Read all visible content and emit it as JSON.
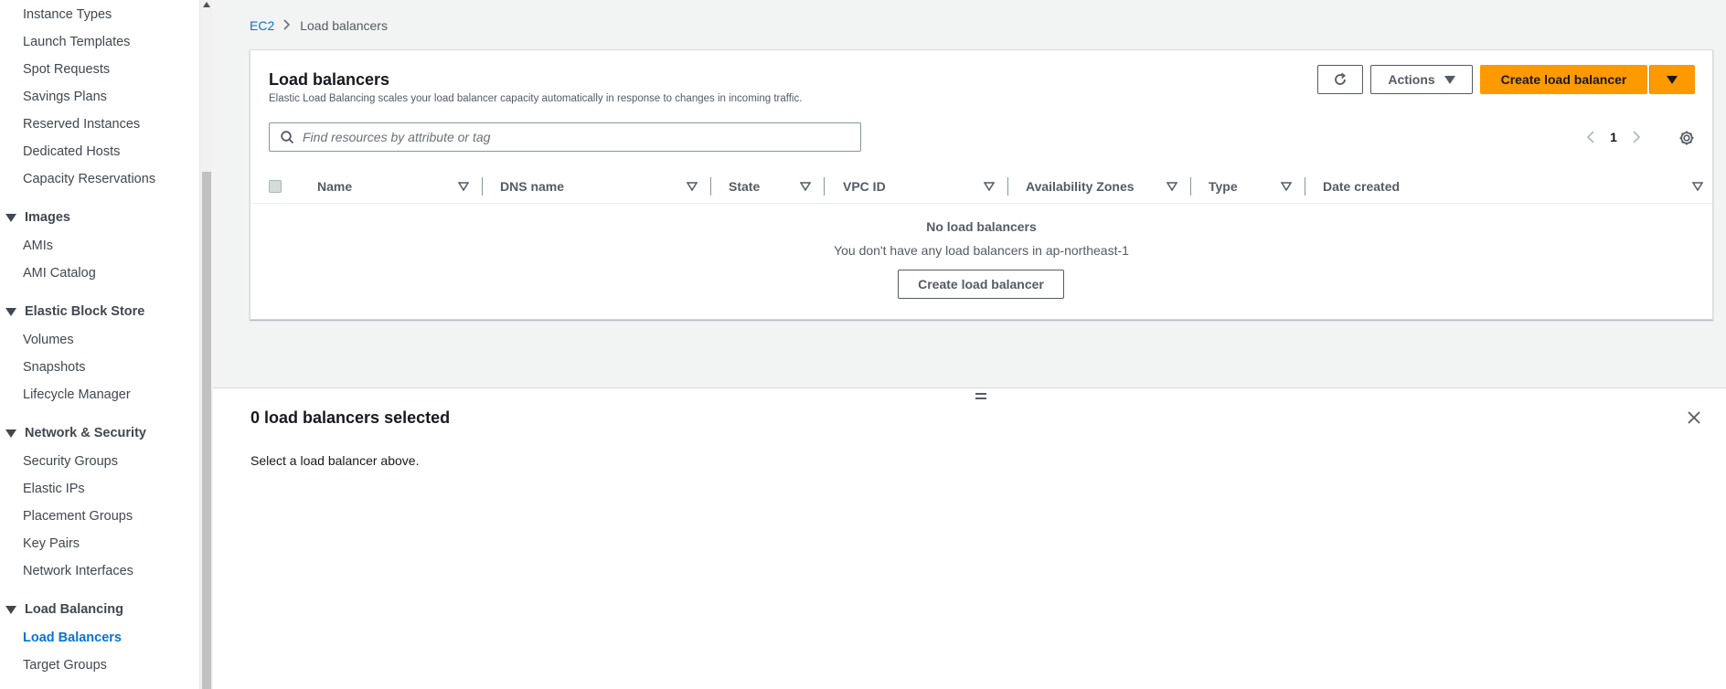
{
  "sidebar": {
    "items": [
      {
        "label": "Instance Types"
      },
      {
        "label": "Launch Templates"
      },
      {
        "label": "Spot Requests"
      },
      {
        "label": "Savings Plans"
      },
      {
        "label": "Reserved Instances"
      },
      {
        "label": "Dedicated Hosts"
      },
      {
        "label": "Capacity Reservations"
      }
    ],
    "images": {
      "heading": "Images",
      "items": [
        {
          "label": "AMIs"
        },
        {
          "label": "AMI Catalog"
        }
      ]
    },
    "ebs": {
      "heading": "Elastic Block Store",
      "items": [
        {
          "label": "Volumes"
        },
        {
          "label": "Snapshots"
        },
        {
          "label": "Lifecycle Manager"
        }
      ]
    },
    "network": {
      "heading": "Network & Security",
      "items": [
        {
          "label": "Security Groups"
        },
        {
          "label": "Elastic IPs"
        },
        {
          "label": "Placement Groups"
        },
        {
          "label": "Key Pairs"
        },
        {
          "label": "Network Interfaces"
        }
      ]
    },
    "lb": {
      "heading": "Load Balancing",
      "items": [
        {
          "label": "Load Balancers",
          "active": true
        },
        {
          "label": "Target Groups"
        }
      ]
    }
  },
  "breadcrumb": {
    "root": "EC2",
    "current": "Load balancers"
  },
  "panel": {
    "title": "Load balancers",
    "description": "Elastic Load Balancing scales your load balancer capacity automatically in response to changes in incoming traffic.",
    "actions_label": "Actions",
    "create_label": "Create load balancer"
  },
  "search": {
    "placeholder": "Find resources by attribute or tag"
  },
  "pagination": {
    "current_page": "1"
  },
  "table": {
    "columns": [
      "Name",
      "DNS name",
      "State",
      "VPC ID",
      "Availability Zones",
      "Type",
      "Date created"
    ],
    "empty_title": "No load balancers",
    "empty_description": "You don't have any load balancers in ap-northeast-1",
    "empty_button": "Create load balancer"
  },
  "split_panel": {
    "title": "0 load balancers selected",
    "description": "Select a load balancer above."
  },
  "colors": {
    "accent": "#ff9900",
    "link": "#0972d3"
  }
}
